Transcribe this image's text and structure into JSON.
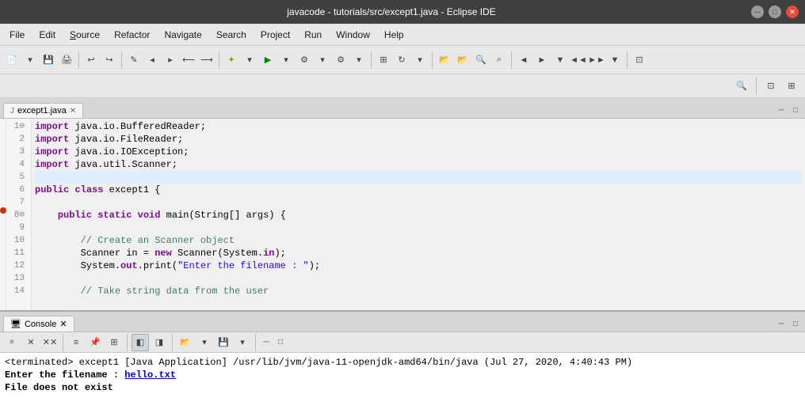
{
  "titlebar": {
    "title": "javacode - tutorials/src/except1.java - Eclipse IDE",
    "min_label": "─",
    "max_label": "□",
    "close_label": "✕"
  },
  "menubar": {
    "items": [
      {
        "label": "File",
        "id": "file"
      },
      {
        "label": "Edit",
        "id": "edit"
      },
      {
        "label": "Source",
        "id": "source"
      },
      {
        "label": "Refactor",
        "id": "refactor"
      },
      {
        "label": "Navigate",
        "id": "navigate"
      },
      {
        "label": "Search",
        "id": "search"
      },
      {
        "label": "Project",
        "id": "project"
      },
      {
        "label": "Run",
        "id": "run"
      },
      {
        "label": "Window",
        "id": "window"
      },
      {
        "label": "Help",
        "id": "help"
      }
    ]
  },
  "editor": {
    "tab_label": "except1.java",
    "tab_close": "✕",
    "lines": [
      {
        "num": "1",
        "fold": "⊖",
        "content_html": "<span class='import-kw'>import</span> java.io.BufferedReader;"
      },
      {
        "num": "2",
        "fold": "",
        "content_html": "<span class='import-kw'>import</span> java.io.FileReader;"
      },
      {
        "num": "3",
        "fold": "",
        "content_html": "<span class='import-kw'>import</span> java.io.IOException;"
      },
      {
        "num": "4",
        "fold": "",
        "content_html": "<span class='import-kw'>import</span> java.util.Scanner;"
      },
      {
        "num": "5",
        "fold": "",
        "content_html": ""
      },
      {
        "num": "6",
        "fold": "",
        "content_html": "<span class='kw'>public</span> <span class='kw'>class</span> except1 {"
      },
      {
        "num": "7",
        "fold": "",
        "content_html": ""
      },
      {
        "num": "8",
        "fold": "⊖",
        "content_html": "    <span class='kw'>public</span> <span class='kw'>static</span> <span class='kw'>void</span> main(String[] args) {",
        "breakpoint": true
      },
      {
        "num": "9",
        "fold": "",
        "content_html": ""
      },
      {
        "num": "10",
        "fold": "",
        "content_html": "        <span class='comment'>// Create an Scanner object</span>"
      },
      {
        "num": "11",
        "fold": "",
        "content_html": "        Scanner in = <span class='kw'>new</span> Scanner(System.<span class='kw'>in</span>);"
      },
      {
        "num": "12",
        "fold": "",
        "content_html": "        System.<span class='kw'>out</span>.print(\"Enter the filename : \");"
      },
      {
        "num": "13",
        "fold": "",
        "content_html": ""
      },
      {
        "num": "14",
        "fold": "",
        "content_html": "        <span class='comment'>// Take string data from the user</span>"
      }
    ]
  },
  "console": {
    "tab_label": "Console",
    "tab_close": "✕",
    "output_line1": "<terminated> except1 [Java Application] /usr/lib/jvm/java-11-openjdk-amd64/bin/java (Jul 27, 2020, 4:40:43 PM)",
    "output_line2_prefix": "Enter the filename : ",
    "output_line2_link": "hello.txt",
    "output_line3": "File does not exist"
  },
  "icons": {
    "file_icon": "📄",
    "console_icon": "🖥",
    "search_icon": "🔍",
    "gear_icon": "⚙"
  }
}
